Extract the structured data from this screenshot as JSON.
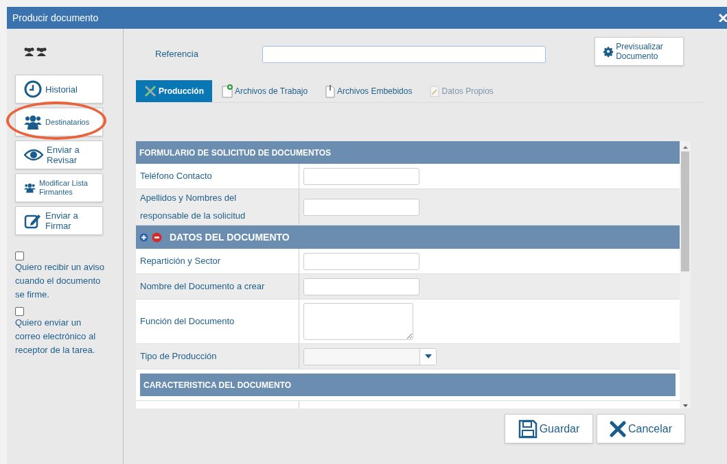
{
  "window": {
    "title": "Producir documento"
  },
  "sidebar": {
    "actions": [
      {
        "label": "Historial",
        "highlighted": false
      },
      {
        "label": "Destinatarios",
        "highlighted": true
      },
      {
        "label": "Enviar a Revisar",
        "highlighted": false
      },
      {
        "label": "Modificar Lista Firmantes",
        "highlighted": false
      },
      {
        "label": "Enviar a Firmar",
        "highlighted": false
      }
    ],
    "options": [
      {
        "label": "Quiero recibir un aviso cuando el documento se firme.",
        "checked": false
      },
      {
        "label": "Quiero enviar un correo electrónico al receptor de la tarea.",
        "checked": false
      }
    ]
  },
  "reference": {
    "label": "Referencia"
  },
  "preview_button": "Previsualizar Documento",
  "tabs": [
    {
      "label": "Producción",
      "selected": true,
      "disabled": false
    },
    {
      "label": "Archivos de Trabajo",
      "selected": false,
      "disabled": false
    },
    {
      "label": "Archivos Embebidos",
      "selected": false,
      "disabled": false
    },
    {
      "label": "Datos Propios",
      "selected": false,
      "disabled": true
    }
  ],
  "form": [
    {
      "kind": "header",
      "label": "FORMULARIO DE SOLICITUD DE DOCUMENTOS",
      "collapsible": false
    },
    {
      "kind": "text",
      "label": "Teléfono Contacto"
    },
    {
      "kind": "text",
      "label": "Apellidos y Nombres del responsable de la solicitud"
    },
    {
      "kind": "header",
      "label": "DATOS DEL DOCUMENTO",
      "collapsible": true
    },
    {
      "kind": "text",
      "label": "Repartición y Sector"
    },
    {
      "kind": "text",
      "label": "Nombre del Documento a crear"
    },
    {
      "kind": "textarea",
      "label": "Función del Documento"
    },
    {
      "kind": "select",
      "label": "Tipo de Producción"
    },
    {
      "kind": "subheader",
      "label": "CARACTERISTICA DEL DOCUMENTO"
    }
  ],
  "buttons": [
    {
      "label": "Guardar"
    },
    {
      "label": "Cancelar"
    }
  ]
}
